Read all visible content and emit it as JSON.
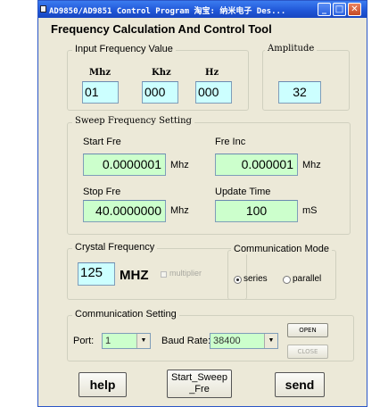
{
  "titlebar": {
    "title": "AD9850/AD9851 Control Program     淘宝: 纳米电子     Des...",
    "min": "_",
    "max": "□",
    "close": "✕"
  },
  "heading": "Frequency Calculation And Control Tool",
  "input_freq": {
    "legend": "Input Frequency Value",
    "mhz_label": "Mhz",
    "khz_label": "Khz",
    "hz_label": "Hz",
    "mhz_value": "01",
    "khz_value": "000",
    "hz_value": "000"
  },
  "amplitude": {
    "legend": "Amplitude",
    "value": "32"
  },
  "sweep": {
    "legend": "Sweep Frequency Setting",
    "start_label": "Start Fre",
    "start_value": "0.0000001",
    "start_unit": "Mhz",
    "inc_label": "Fre Inc",
    "inc_value": "0.000001",
    "inc_unit": "Mhz",
    "stop_label": "Stop Fre",
    "stop_value": "40.0000000",
    "stop_unit": "Mhz",
    "update_label": "Update Time",
    "update_value": "100",
    "update_unit": "mS"
  },
  "crystal": {
    "legend": "Crystal Frequency",
    "value": "125",
    "unit": "MHZ",
    "multiplier_label": "multiplier"
  },
  "comm_mode": {
    "legend": "Communication Mode",
    "serial_label": "series",
    "parallel_label": "parallel"
  },
  "comm_setting": {
    "legend": "Communication Setting",
    "port_label": "Port:",
    "port_value": "1",
    "baud_label": "Baud Rate:",
    "baud_value": "38400",
    "open_label": "OPEN",
    "close_label": "CLOSE"
  },
  "buttons": {
    "help": "help",
    "sweep_line1": "Start_Sweep",
    "sweep_line2": "_Fre",
    "send": "send"
  }
}
